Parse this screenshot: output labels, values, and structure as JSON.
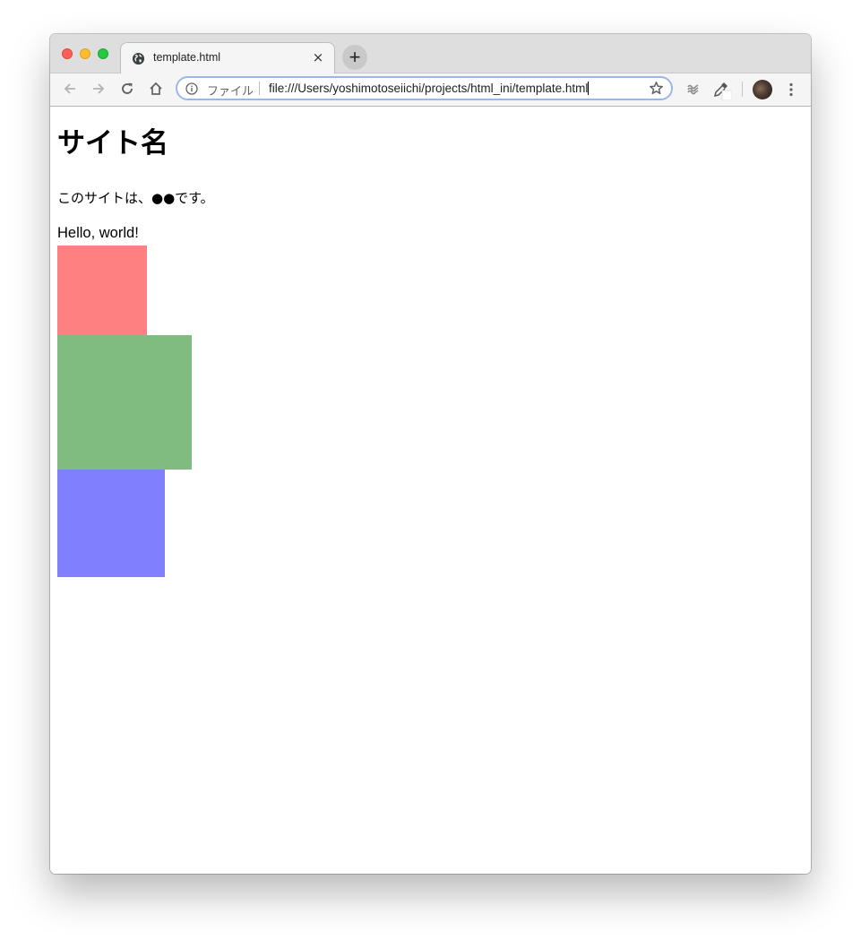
{
  "browser": {
    "tab": {
      "title": "template.html",
      "favicon": "globe-icon",
      "close": "×"
    },
    "new_tab": "+",
    "address_bar": {
      "scheme_label": "ファイル",
      "url": "file:///Users/yoshimotoseiichi/projects/html_ini/template.html"
    },
    "icons": [
      "back-icon",
      "forward-icon",
      "reload-icon",
      "home-icon",
      "info-icon",
      "star-icon",
      "extension-icon",
      "eyedropper-icon",
      "avatar",
      "more-menu-icon"
    ]
  },
  "page": {
    "title": "サイト名",
    "description": "このサイトは、●●です。",
    "greeting": "Hello, world!",
    "boxes": [
      {
        "name": "red-box",
        "color": "#ff8080"
      },
      {
        "name": "green-box",
        "color": "#80bb80"
      },
      {
        "name": "blue-box",
        "color": "#8080ff"
      }
    ]
  }
}
